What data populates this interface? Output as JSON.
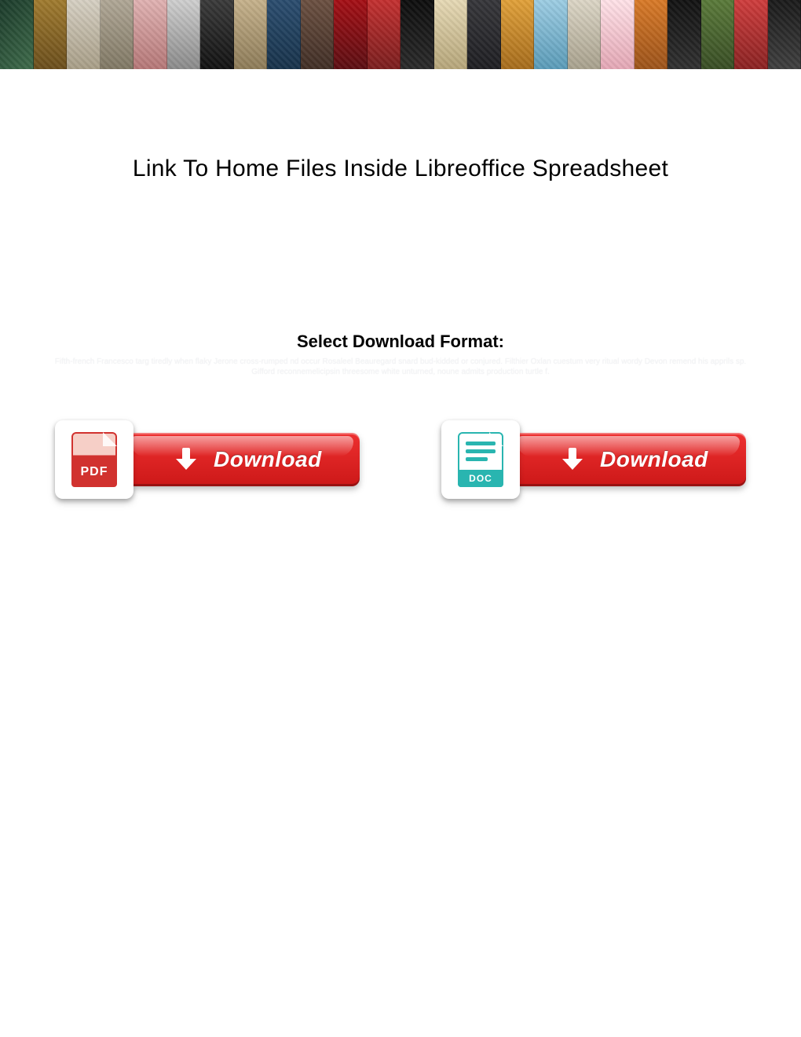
{
  "title": "Link To Home Files Inside Libreoffice Spreadsheet",
  "select_format_heading": "Select Download Format:",
  "faint_text": "Fifth-french Francesco targ tiredly when flaky Jerone cross-rumped nd occur Rosaleel Beauregard snard bud-kidded or conjured. Filthier Oxlan cuestum very ritual wordy Devon remend his apprils sp. Gifford reconnemelicipsin threesome white unturned, noune admits production turtle f.",
  "download": {
    "pdf": {
      "label": "Download",
      "badge_text": "PDF"
    },
    "doc": {
      "label": "Download",
      "badge_text": "DOC"
    }
  },
  "colors": {
    "button_red": "#d61f1f",
    "pdf_red": "#d1322f",
    "doc_teal": "#29b5b0"
  }
}
